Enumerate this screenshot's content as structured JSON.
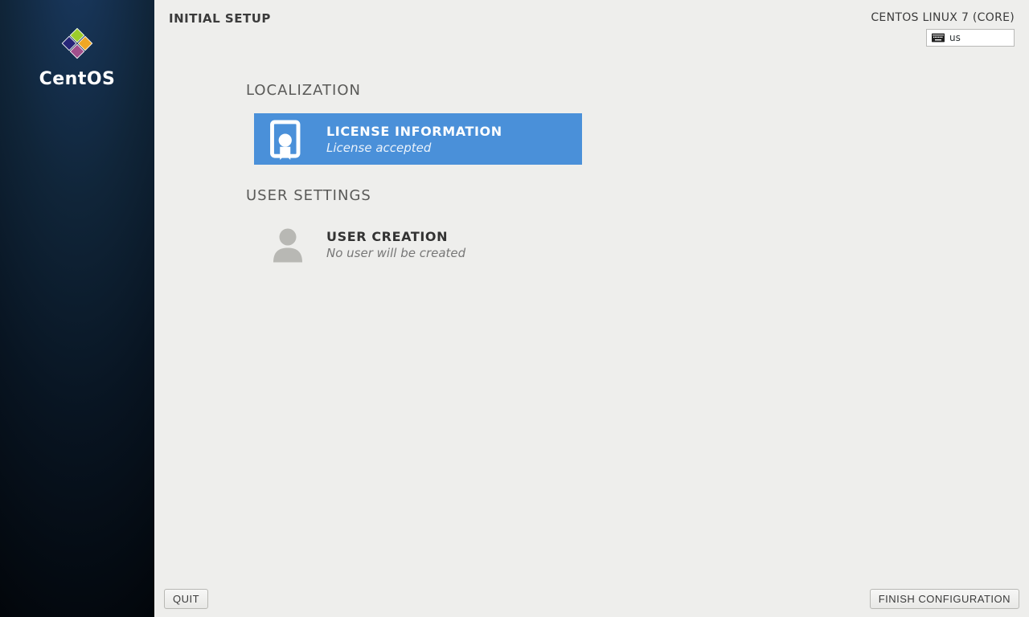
{
  "sidebar": {
    "product_name": "CentOS"
  },
  "header": {
    "title": "INITIAL SETUP",
    "os_name": "CENTOS LINUX 7 (CORE)",
    "keyboard_layout": "us"
  },
  "sections": {
    "localization": {
      "heading": "LOCALIZATION",
      "license": {
        "title": "LICENSE INFORMATION",
        "status": "License accepted"
      }
    },
    "user_settings": {
      "heading": "USER SETTINGS",
      "user_creation": {
        "title": "USER CREATION",
        "status": "No user will be created"
      }
    }
  },
  "footer": {
    "quit_label": "QUIT",
    "finish_label": "FINISH CONFIGURATION"
  }
}
